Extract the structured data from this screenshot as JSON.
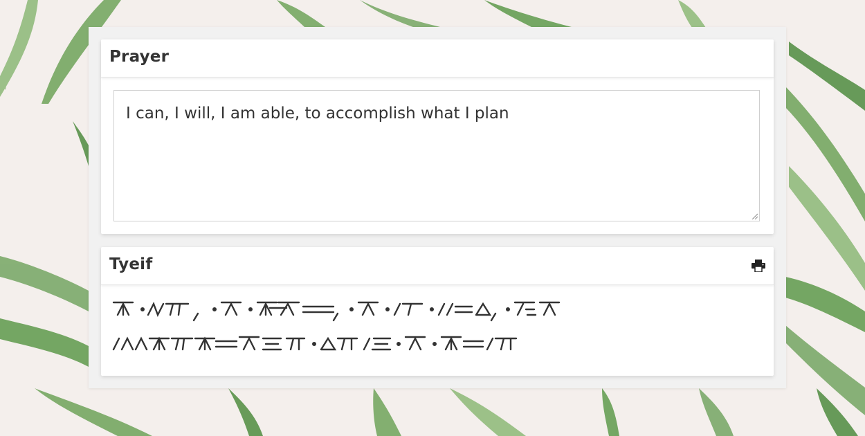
{
  "prayer": {
    "title": "Prayer",
    "text": "I can, I will, I am able, to accomplish what I plan"
  },
  "tyeif": {
    "title": "Tyeif",
    "print_icon": "printer-icon",
    "script_lines": [
      "Ι can, I will, I am able, to",
      "accomplish what I plan"
    ]
  },
  "colors": {
    "page_bg": "#f4efec",
    "card_bg": "#ffffff",
    "panel_bg": "#f1f1f1",
    "leaf_green": "#5e9a4c",
    "text": "#333333"
  }
}
